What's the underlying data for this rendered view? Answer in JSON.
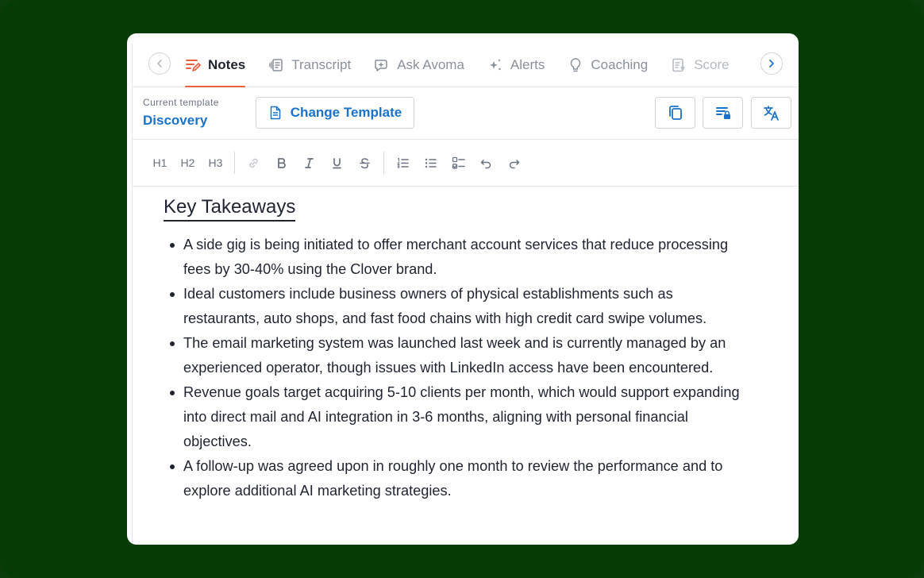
{
  "tabs": [
    {
      "label": "Notes",
      "icon": "notes-icon",
      "active": true
    },
    {
      "label": "Transcript",
      "icon": "transcript-icon"
    },
    {
      "label": "Ask Avoma",
      "icon": "ask-avoma-icon"
    },
    {
      "label": "Alerts",
      "icon": "sparkle-icon"
    },
    {
      "label": "Coaching",
      "icon": "lightbulb-icon"
    },
    {
      "label": "Score",
      "icon": "scorecard-icon"
    }
  ],
  "template": {
    "label": "Current template",
    "name": "Discovery",
    "change_label": "Change Template"
  },
  "toolbar": {
    "h1": "H1",
    "h2": "H2",
    "h3": "H3"
  },
  "notes": {
    "heading": "Key Takeaways",
    "bullets": [
      "A side gig is being initiated to offer merchant account services that reduce processing fees by 30-40% using the Clover brand.",
      "Ideal customers include business owners of physical establishments such as restaurants, auto shops, and fast food chains with high credit card swipe volumes.",
      "The email marketing system was launched last week and is currently managed by an experienced operator, though issues with LinkedIn access have been encountered.",
      "Revenue goals target acquiring 5-10 clients per month, which would support expanding into direct mail and AI integration in 3-6 months, aligning with personal financial objectives.",
      "A follow-up was agreed upon in roughly one month to review the performance and to explore additional AI marketing strategies."
    ]
  },
  "colors": {
    "background": "#053b05",
    "accent_tab": "#e8613f",
    "link_blue": "#1a73c8"
  }
}
